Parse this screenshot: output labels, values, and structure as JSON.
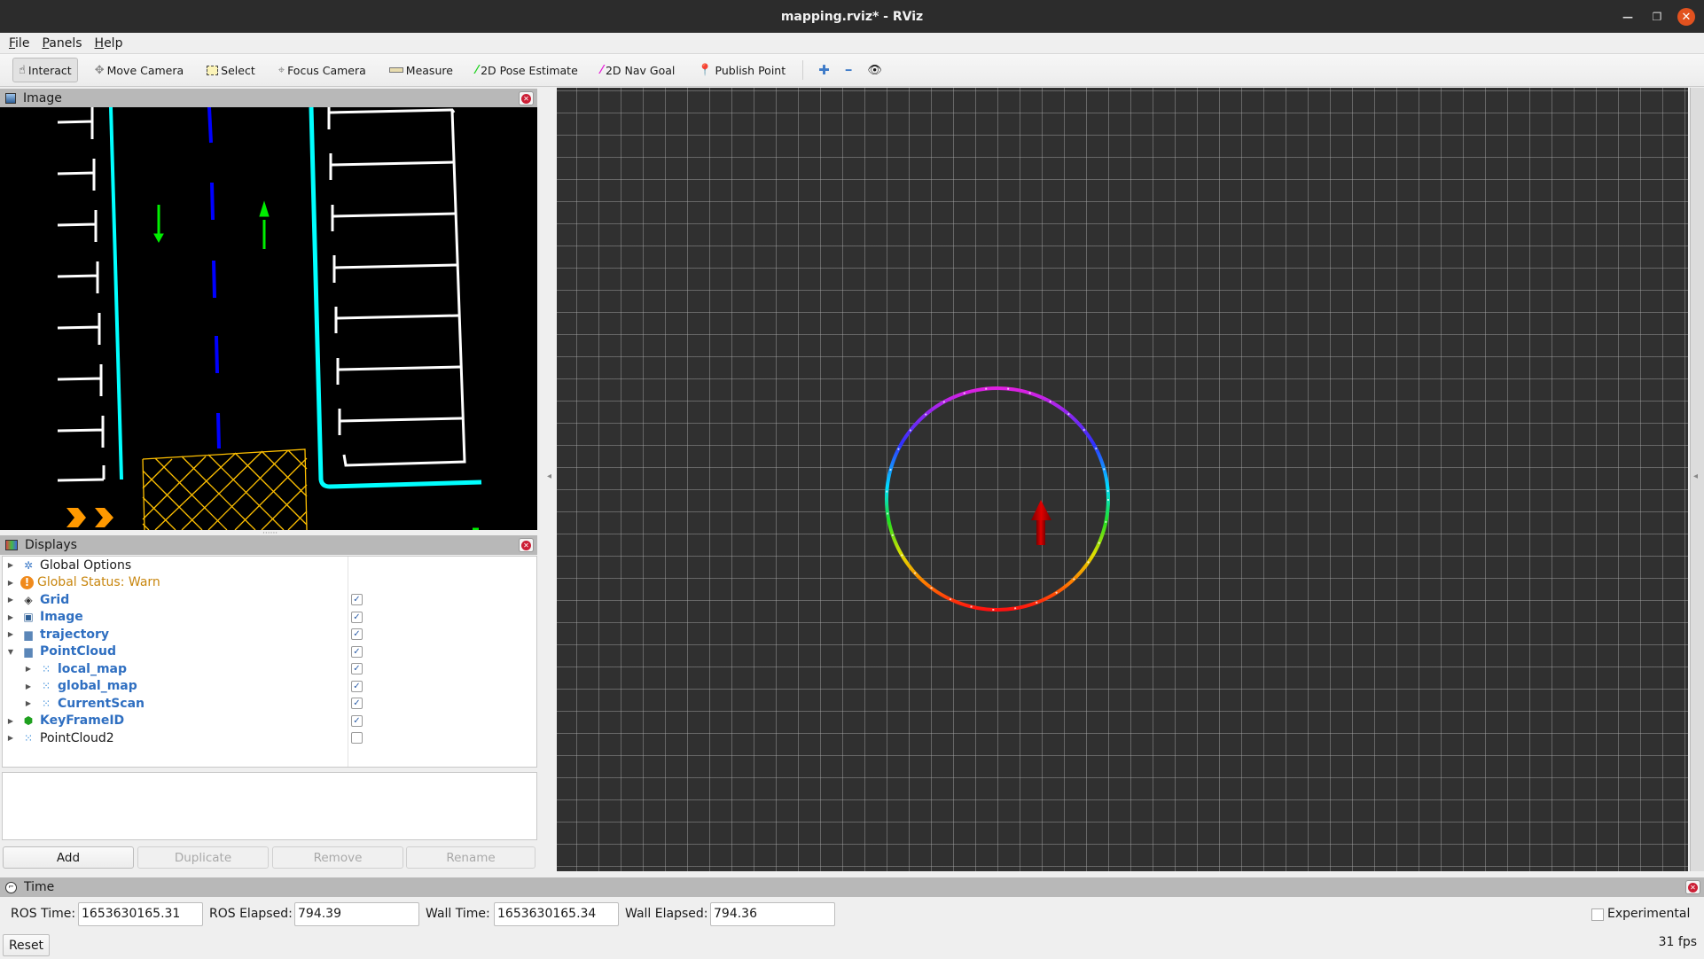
{
  "window": {
    "title": "mapping.rviz* - RViz"
  },
  "menu": [
    {
      "label": "File"
    },
    {
      "label": "Panels"
    },
    {
      "label": "Help"
    }
  ],
  "toolbar": {
    "tools": [
      {
        "label": "Interact",
        "icon": "hand-pointer-icon",
        "active": true
      },
      {
        "label": "Move Camera",
        "icon": "move-camera-icon"
      },
      {
        "label": "Select",
        "icon": "select-box-icon"
      },
      {
        "label": "Focus Camera",
        "icon": "focus-crosshair-icon"
      },
      {
        "label": "Measure",
        "icon": "ruler-icon"
      },
      {
        "label": "2D Pose Estimate",
        "icon": "green-arrow-icon"
      },
      {
        "label": "2D Nav Goal",
        "icon": "magenta-arrow-icon"
      },
      {
        "label": "Publish Point",
        "icon": "map-pin-icon"
      }
    ],
    "extra": [
      {
        "icon": "plus-icon",
        "glyph": "✚"
      },
      {
        "icon": "minus-icon",
        "glyph": "━"
      },
      {
        "icon": "eye-icon",
        "glyph": "👁"
      }
    ]
  },
  "image_panel": {
    "title": "Image"
  },
  "displays_panel": {
    "title": "Displays",
    "items": [
      {
        "label": "Global Options",
        "style": "normal",
        "icon": "gear-icon",
        "depth": 0,
        "expanded": false,
        "checkbox": null
      },
      {
        "label": "Global Status: Warn",
        "style": "warn",
        "icon": "warning-icon",
        "depth": 0,
        "expanded": false,
        "checkbox": null
      },
      {
        "label": "Grid",
        "style": "blue",
        "icon": "grid-icon",
        "depth": 0,
        "expanded": false,
        "checkbox": true
      },
      {
        "label": "Image",
        "style": "blue",
        "icon": "image-icon",
        "depth": 0,
        "expanded": false,
        "checkbox": true
      },
      {
        "label": "trajectory",
        "style": "blue",
        "icon": "folder-icon",
        "depth": 0,
        "expanded": false,
        "checkbox": true
      },
      {
        "label": "PointCloud",
        "style": "blue",
        "icon": "folder-icon",
        "depth": 0,
        "expanded": true,
        "checkbox": true
      },
      {
        "label": "local_map",
        "style": "blue",
        "icon": "pointcloud-icon",
        "depth": 1,
        "expanded": false,
        "checkbox": true
      },
      {
        "label": "global_map",
        "style": "blue",
        "icon": "pointcloud-icon",
        "depth": 1,
        "expanded": false,
        "checkbox": true
      },
      {
        "label": "CurrentScan",
        "style": "blue",
        "icon": "pointcloud-icon",
        "depth": 1,
        "expanded": false,
        "checkbox": true
      },
      {
        "label": "KeyFrameID",
        "style": "blue",
        "icon": "green-cube-icon",
        "depth": 0,
        "expanded": false,
        "checkbox": true
      },
      {
        "label": "PointCloud2",
        "style": "normal",
        "icon": "pointcloud-icon",
        "depth": 0,
        "expanded": false,
        "checkbox": false
      }
    ],
    "buttons": [
      {
        "label": "Add",
        "enabled": true
      },
      {
        "label": "Duplicate",
        "enabled": false
      },
      {
        "label": "Remove",
        "enabled": false
      },
      {
        "label": "Rename",
        "enabled": false
      }
    ]
  },
  "time_panel": {
    "title": "Time",
    "ros_time_label": "ROS Time:",
    "ros_time": "1653630165.31",
    "ros_elapsed_label": "ROS Elapsed:",
    "ros_elapsed": "794.39",
    "wall_time_label": "Wall Time:",
    "wall_time": "1653630165.34",
    "wall_elapsed_label": "Wall Elapsed:",
    "wall_elapsed": "794.36",
    "experimental_label": "Experimental",
    "experimental_checked": false,
    "reset_label": "Reset",
    "fps": "31 fps"
  },
  "colors": {
    "grid_background": "#303030",
    "lane_boundary": "#00ffff",
    "center_dash": "#0000ff",
    "arrow_marking": "#00ff00",
    "hatch": "#ffc000",
    "chevron": "#ff9900",
    "pose_arrow": "#cc0000",
    "status_warn": "#c8860e",
    "display_blue": "#2f6fc1"
  }
}
